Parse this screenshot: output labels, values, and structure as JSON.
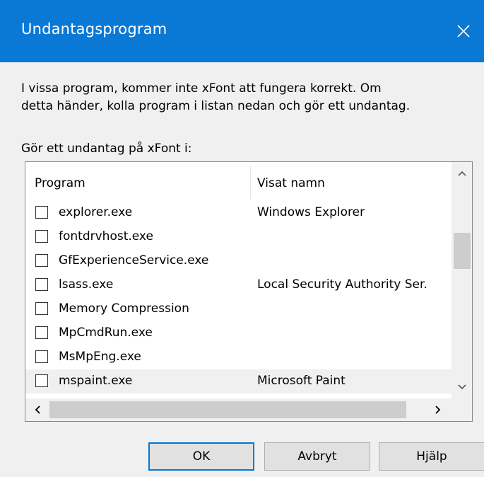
{
  "window": {
    "title": "Undantagsprogram"
  },
  "message": "I vissa program, kommer inte xFont att fungera korrekt.  Om\ndetta händer, kolla program i listan nedan och gör ett undantag.",
  "list_label": "Gör ett undantag på xFont i:",
  "list": {
    "columns": [
      "Program",
      "Visat namn"
    ],
    "rows": [
      {
        "program": "explorer.exe",
        "name": "Windows Explorer",
        "checked": false
      },
      {
        "program": "fontdrvhost.exe",
        "name": "",
        "checked": false
      },
      {
        "program": "GfExperienceService.exe",
        "name": "",
        "checked": false
      },
      {
        "program": "lsass.exe",
        "name": "Local Security Authority Ser.",
        "checked": false
      },
      {
        "program": "Memory Compression",
        "name": "",
        "checked": false
      },
      {
        "program": "MpCmdRun.exe",
        "name": "",
        "checked": false
      },
      {
        "program": "MsMpEng.exe",
        "name": "",
        "checked": false
      },
      {
        "program": "mspaint.exe",
        "name": "Microsoft Paint",
        "checked": false
      }
    ]
  },
  "buttons": {
    "ok": "OK",
    "cancel": "Avbryt",
    "help": "Hjälp"
  },
  "colors": {
    "titlebar": "#0a79d6",
    "default_button_border": "#0078d7"
  }
}
